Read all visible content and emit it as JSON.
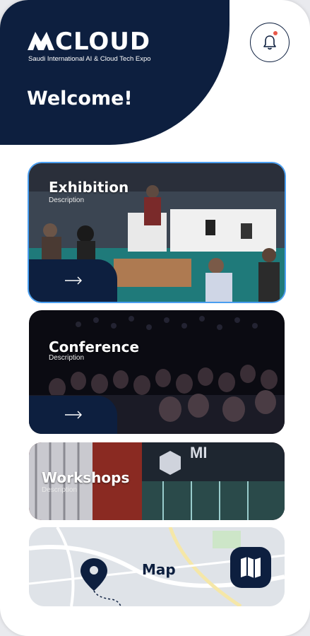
{
  "brand": {
    "logo_text": "CLOUD",
    "logo_mark": "M",
    "tagline": "Saudi International AI & Cloud Tech Expo"
  },
  "header": {
    "welcome": "Welcome!",
    "notification_icon": "bell-icon",
    "notification_badge_color": "#e8584a"
  },
  "cards": [
    {
      "title": "Exhibition",
      "description": "Description",
      "action_icon": "arrow-right-icon"
    },
    {
      "title": "Conference",
      "description": "Description",
      "action_icon": "arrow-right-icon"
    },
    {
      "title": "Workshops",
      "description": "Description"
    }
  ],
  "map": {
    "label": "Map",
    "pin_icon": "map-pin-icon",
    "button_icon": "folded-map-icon"
  },
  "colors": {
    "primary": "#0d1f3f",
    "selected_outline": "#4a9ef0"
  }
}
